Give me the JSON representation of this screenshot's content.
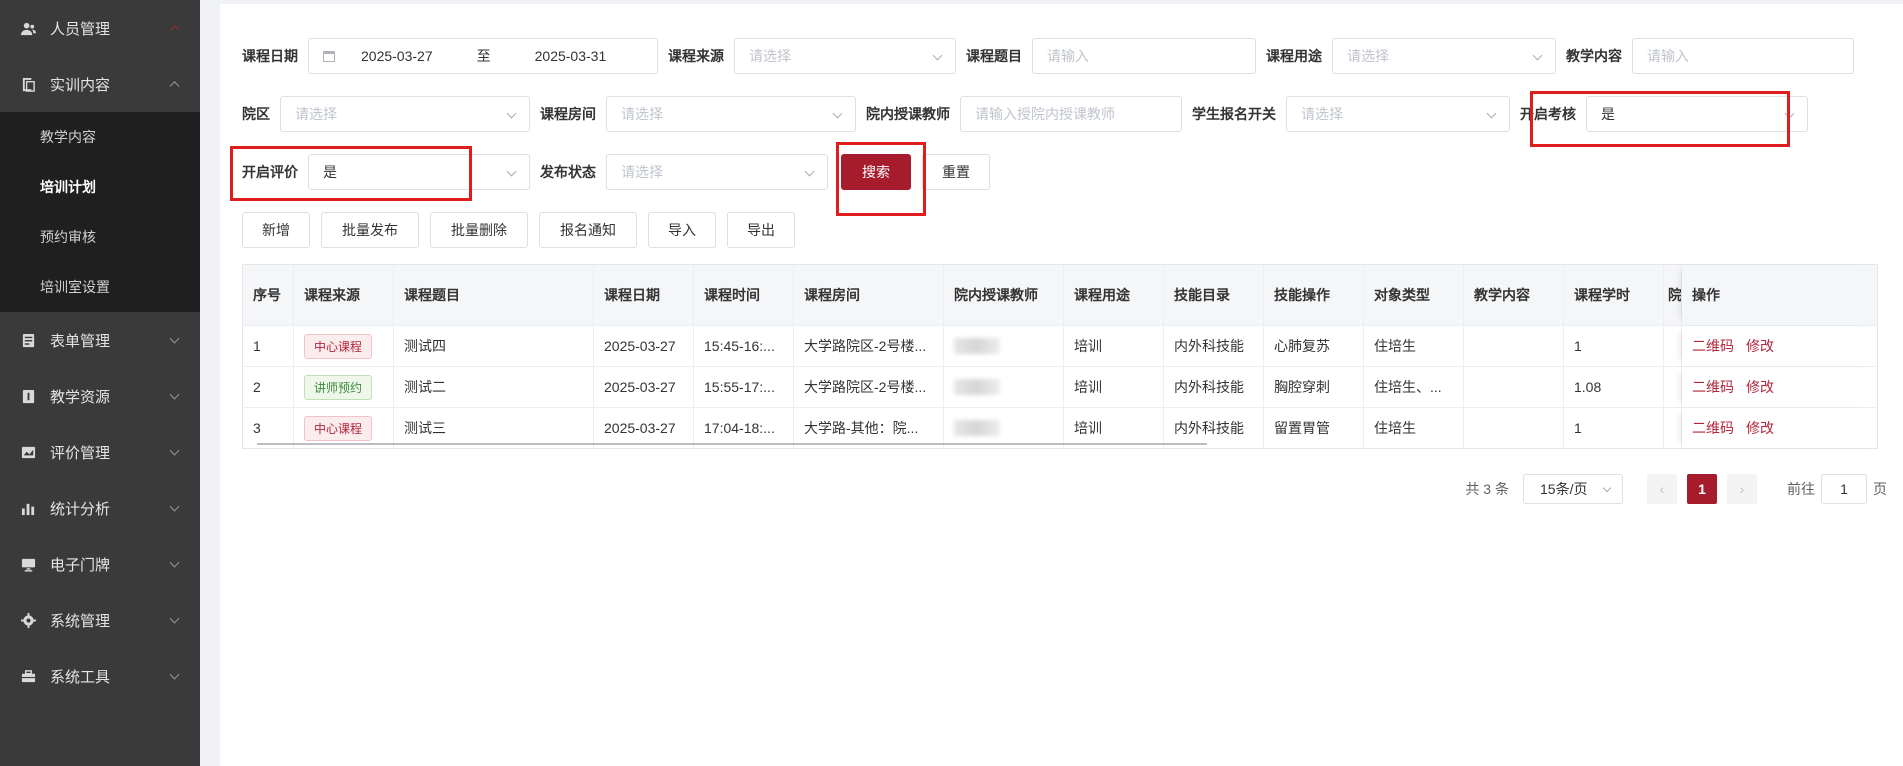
{
  "sidebar": {
    "items": [
      {
        "label": "人员管理",
        "icon": "users-icon",
        "expanded": false
      },
      {
        "label": "实训内容",
        "icon": "book-icon",
        "expanded": true,
        "children": [
          {
            "label": "教学内容",
            "active": false
          },
          {
            "label": "培训计划",
            "active": true
          },
          {
            "label": "预约审核",
            "active": false
          },
          {
            "label": "培训室设置",
            "active": false
          }
        ]
      },
      {
        "label": "表单管理",
        "icon": "form-icon",
        "expanded": false
      },
      {
        "label": "教学资源",
        "icon": "resource-icon",
        "expanded": false
      },
      {
        "label": "评价管理",
        "icon": "evaluation-icon",
        "expanded": false
      },
      {
        "label": "统计分析",
        "icon": "bar-chart-icon",
        "expanded": false
      },
      {
        "label": "电子门牌",
        "icon": "monitor-icon",
        "expanded": false
      },
      {
        "label": "系统管理",
        "icon": "gear-icon",
        "expanded": false
      },
      {
        "label": "系统工具",
        "icon": "toolbox-icon",
        "expanded": false
      }
    ]
  },
  "filters": {
    "course_date": {
      "label": "课程日期",
      "start": "2025-03-27",
      "sep": "至",
      "end": "2025-03-31"
    },
    "course_source": {
      "label": "课程来源",
      "placeholder": "请选择"
    },
    "course_title": {
      "label": "课程题目",
      "placeholder": "请输入"
    },
    "course_purpose": {
      "label": "课程用途",
      "placeholder": "请选择"
    },
    "teaching_content": {
      "label": "教学内容",
      "placeholder": "请输入"
    },
    "campus": {
      "label": "院区",
      "placeholder": "请选择"
    },
    "course_room": {
      "label": "课程房间",
      "placeholder": "请选择"
    },
    "teacher": {
      "label": "院内授课教师",
      "placeholder": "请输入授院内授课教师"
    },
    "student_enroll": {
      "label": "学生报名开关",
      "placeholder": "请选择"
    },
    "enable_exam": {
      "label": "开启考核",
      "value": "是"
    },
    "enable_evaluation": {
      "label": "开启评价",
      "value": "是"
    },
    "publish_status": {
      "label": "发布状态",
      "placeholder": "请选择"
    },
    "search_label": "搜索",
    "reset_label": "重置"
  },
  "toolbar": {
    "add": "新增",
    "batch_publish": "批量发布",
    "batch_delete": "批量删除",
    "enroll_notice": "报名通知",
    "import": "导入",
    "export": "导出"
  },
  "table": {
    "headers": [
      "序号",
      "课程来源",
      "课程题目",
      "课程日期",
      "课程时间",
      "课程房间",
      "院内授课教师",
      "课程用途",
      "技能目录",
      "技能操作",
      "对象类型",
      "教学内容",
      "课程学时",
      "院",
      "操作"
    ],
    "rows": [
      {
        "no": "1",
        "source": "中心课程",
        "source_type": "center",
        "title": "测试四",
        "date": "2025-03-27",
        "time": "15:45-16:...",
        "room": "大学路院区-2号楼...",
        "purpose": "培训",
        "skill_dir": "内外科技能",
        "skill_op": "心肺复苏",
        "target": "住培生",
        "content": "",
        "hours": "1"
      },
      {
        "no": "2",
        "source": "讲师预约",
        "source_type": "teacher",
        "title": "测试二",
        "date": "2025-03-27",
        "time": "15:55-17:...",
        "room": "大学路院区-2号楼...",
        "purpose": "培训",
        "skill_dir": "内外科技能",
        "skill_op": "胸腔穿刺",
        "target": "住培生、...",
        "content": "",
        "hours": "1.08"
      },
      {
        "no": "3",
        "source": "中心课程",
        "source_type": "center",
        "title": "测试三",
        "date": "2025-03-27",
        "time": "17:04-18:...",
        "room": "大学路-其他：院...",
        "purpose": "培训",
        "skill_dir": "内外科技能",
        "skill_op": "留置胃管",
        "target": "住培生",
        "content": "",
        "hours": "1"
      }
    ],
    "op_qr": "二维码",
    "op_edit": "修改"
  },
  "pagination": {
    "total": "共 3 条",
    "page_size": "15条/页",
    "prev": "‹",
    "current": "1",
    "next": "›",
    "goto_prefix": "前往",
    "goto_value": "1",
    "goto_suffix": "页"
  },
  "colors": {
    "accent": "#a61c2c",
    "highlight": "#e01d1d"
  }
}
